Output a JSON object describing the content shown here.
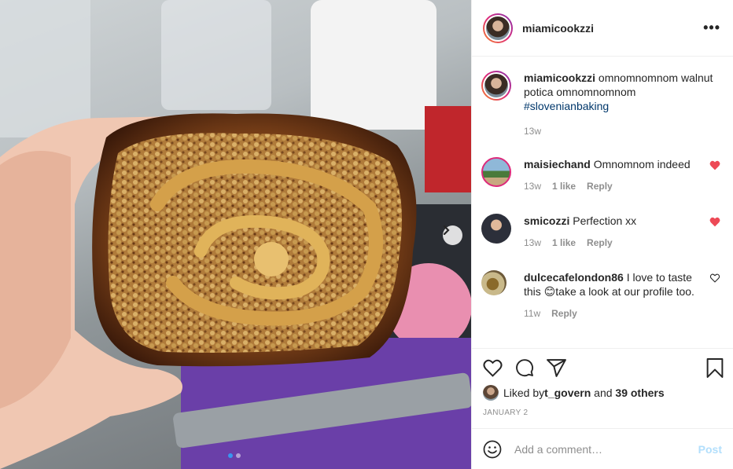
{
  "post": {
    "username": "miamicookzzi",
    "more_icon": "more-horizontal-icon",
    "caption": {
      "username": "miamicookzzi",
      "text": " omnomnomnom walnut potica omnomnomnom",
      "hashtag": "#slovenianbaking",
      "time": "13w"
    },
    "comments": [
      {
        "username": "maisiechand",
        "text": " Omnomnom indeed",
        "time": "13w",
        "likes": "1 like",
        "reply": "Reply",
        "liked": true
      },
      {
        "username": "smicozzi",
        "text": " Perfection xx",
        "time": "13w",
        "likes": "1 like",
        "reply": "Reply",
        "liked": true
      },
      {
        "username": "dulcecafelondon86",
        "text": " I love to taste this 😊take a look at our profile too.",
        "time": "11w",
        "reply": "Reply",
        "liked": false
      }
    ],
    "liked_by": {
      "prefix": "Liked by ",
      "user": "t_govern",
      "middle": " and ",
      "others": "39 others"
    },
    "date": "JANUARY 2",
    "add_comment_placeholder": "Add a comment…",
    "post_label": "Post"
  },
  "colors": {
    "heart_red": "#ed4956",
    "link_blue": "#00376b",
    "post_disabled": "#b2dffc"
  }
}
